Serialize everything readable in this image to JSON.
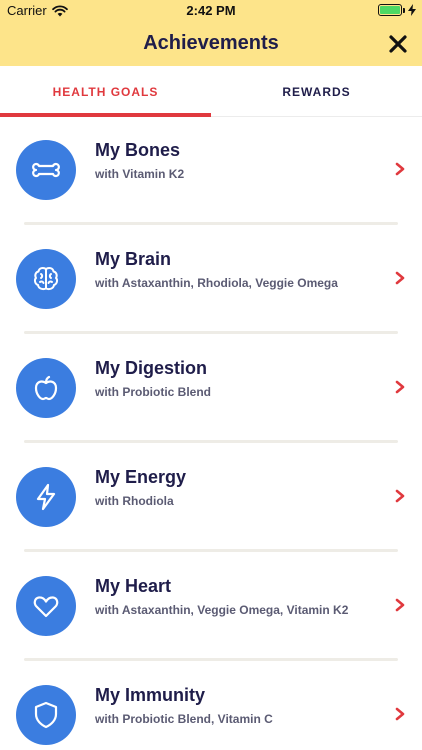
{
  "status_bar": {
    "carrier": "Carrier",
    "time": "2:42 PM"
  },
  "nav": {
    "title": "Achievements"
  },
  "tabs": [
    {
      "label": "HEALTH GOALS",
      "active": true
    },
    {
      "label": "REWARDS",
      "active": false
    }
  ],
  "goals": [
    {
      "title": "My Bones",
      "subtitle": "with Vitamin K2",
      "icon": "bone-icon"
    },
    {
      "title": "My Brain",
      "subtitle": "with Astaxanthin, Rhodiola, Veggie Omega",
      "icon": "brain-icon"
    },
    {
      "title": "My Digestion",
      "subtitle": "with Probiotic Blend",
      "icon": "apple-icon"
    },
    {
      "title": "My Energy",
      "subtitle": "with Rhodiola",
      "icon": "lightning-icon"
    },
    {
      "title": "My Heart",
      "subtitle": "with Astaxanthin, Veggie Omega, Vitamin K2",
      "icon": "heart-icon"
    },
    {
      "title": "My Immunity",
      "subtitle": "with Probiotic Blend, Vitamin C",
      "icon": "shield-icon"
    }
  ],
  "colors": {
    "header_bg": "#fde48a",
    "accent_red": "#e0393e",
    "icon_blue": "#3b7de0",
    "title_navy": "#1f1d4a"
  }
}
